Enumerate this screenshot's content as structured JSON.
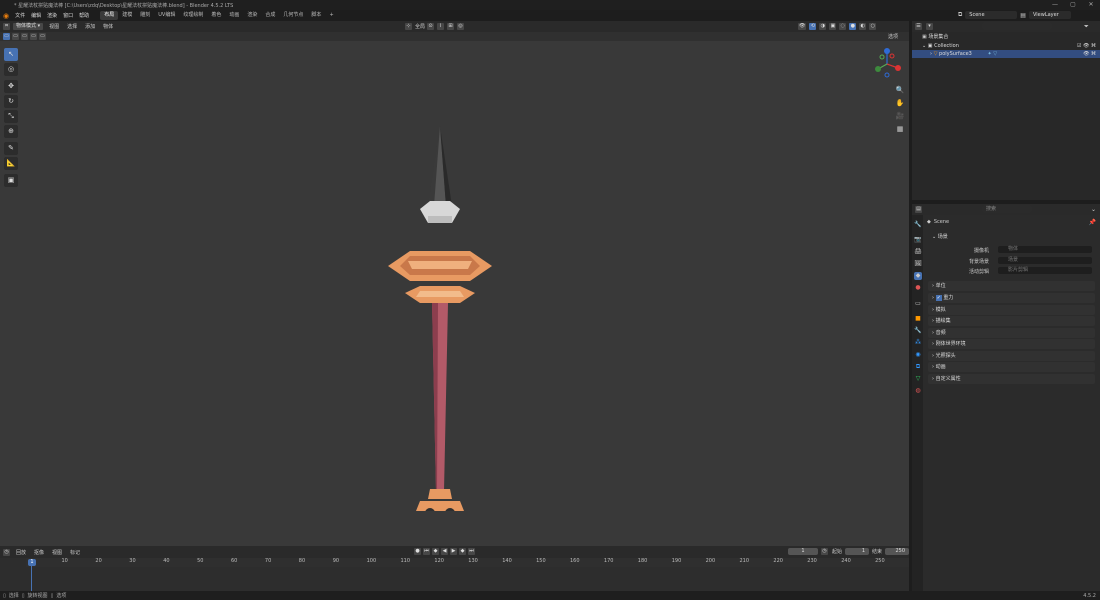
{
  "window": {
    "title": "* 星耀法杖拼贴魔法棒 [C:\\Users\\zdq\\Desktop\\星耀法杖拼贴魔法棒.blend] - Blender 4.5.2 LTS",
    "minimize": "—",
    "maximize": "▢",
    "close": "✕"
  },
  "menu": {
    "items": [
      "文件",
      "编辑",
      "渲染",
      "窗口",
      "帮助"
    ],
    "workspaces": [
      "布局",
      "建模",
      "雕刻",
      "UV编辑",
      "纹理绘制",
      "着色",
      "动画",
      "渲染",
      "合成",
      "几何节点",
      "脚本"
    ],
    "active_workspace": 0,
    "add_tab": "+",
    "scene_name": "Scene",
    "view_layer": "ViewLayer"
  },
  "viewport_header": {
    "mode": "物体模式",
    "menus": [
      "视图",
      "选择",
      "添加",
      "物体"
    ],
    "transform_orientation": "全局",
    "options_label": "选项"
  },
  "outliner": {
    "title": "场景集合",
    "collection": "Collection",
    "object": "polySurface3",
    "search_placeholder": ""
  },
  "properties": {
    "search_placeholder": "搜索",
    "scene_name": "Scene",
    "section_scene": "场景",
    "fields": [
      {
        "label": "摄像机",
        "value": "物体"
      },
      {
        "label": "背景场景",
        "value": "场景"
      },
      {
        "label": "活动剪辑",
        "value": "影片剪辑"
      }
    ],
    "panels": [
      "单位",
      "重力",
      "模拟",
      "描绘集",
      "音频",
      "刚体世界环境",
      "光照探头",
      "动画",
      "自定义属性"
    ]
  },
  "timeline": {
    "menus": [
      "回放",
      "抠像",
      "视图",
      "标记"
    ],
    "current_frame": "1",
    "start_label": "起始",
    "start_value": "1",
    "end_label": "结束",
    "end_value": "250",
    "ticks": [
      "1",
      "10",
      "20",
      "30",
      "40",
      "50",
      "60",
      "70",
      "80",
      "90",
      "100",
      "110",
      "120",
      "130",
      "140",
      "150",
      "160",
      "170",
      "180",
      "190",
      "200",
      "210",
      "220",
      "230",
      "240",
      "250"
    ]
  },
  "status": {
    "select": "选择",
    "rotate_view": "旋转视图",
    "object": "选项",
    "version": "4.5.2"
  },
  "colors": {
    "accent": "#4772b3",
    "viewport_bg": "#393939",
    "staff_orange": "#e8a06c",
    "staff_shaft": "#b35a68"
  }
}
